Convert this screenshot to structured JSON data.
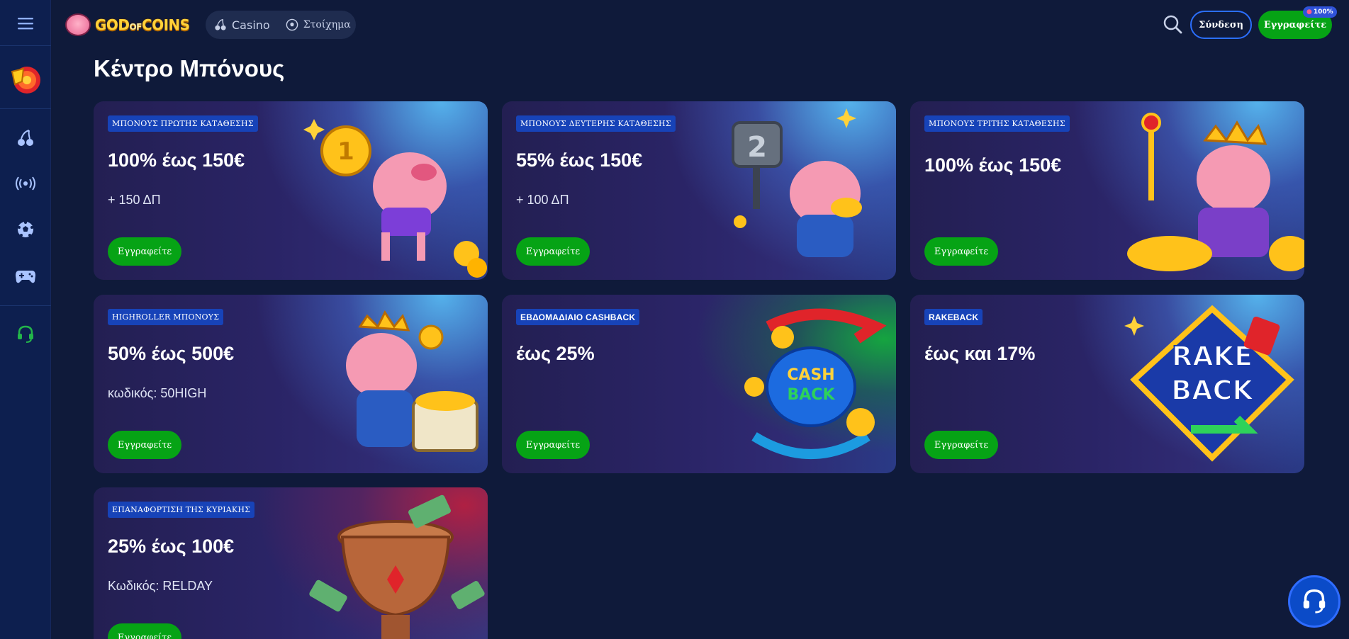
{
  "header": {
    "logo_text_a": "GOD",
    "logo_text_b": "OF",
    "logo_text_c": "COINS",
    "nav": [
      {
        "label": "Casino",
        "icon": "cherry-icon"
      },
      {
        "label": "Στοίχημα",
        "icon": "soccer-ball-icon"
      }
    ],
    "login_label": "Σύνδεση",
    "register_label": "Εγγραφείτε",
    "register_badge": "100%"
  },
  "sidebar": {
    "items": [
      {
        "name": "menu",
        "icon": "hamburger-menu-icon"
      },
      {
        "name": "promotions",
        "icon": "wheel-of-fortune-icon"
      },
      {
        "name": "casino",
        "icon": "cherry-icon"
      },
      {
        "name": "live",
        "icon": "broadcast-icon"
      },
      {
        "name": "sports",
        "icon": "soccer-ball-icon"
      },
      {
        "name": "games",
        "icon": "gamepad-icon"
      },
      {
        "name": "support",
        "icon": "headset-icon"
      }
    ]
  },
  "page": {
    "title": "Κέντρο Μπόνους"
  },
  "cards": [
    {
      "tag": "ΜΠΟΝΟΥΣ ΠΡΩΤΗΣ ΚΑΤΑΘΕΣΗΣ",
      "headline": "100% έως 150€",
      "sub": "+ 150 ΔΠ",
      "button": "Εγγραφείτε",
      "art": "pig-with-gold-coin"
    },
    {
      "tag": "ΜΠΟΝΟΥΣ ΔΕΥΤΕΡΗΣ ΚΑΤΑΘΕΣΗΣ",
      "headline": "55% έως 150€",
      "sub": "+ 100 ΔΠ",
      "button": "Εγγραφείτε",
      "art": "pig-with-hammer"
    },
    {
      "tag": "ΜΠΟΝΟΥΣ ΤΡΙΤΗΣ ΚΑΤΑΘΕΣΗΣ",
      "headline": "100% έως 150€",
      "sub": "",
      "button": "Εγγραφείτε",
      "art": "king-pig"
    },
    {
      "tag": "HIGHROLLER ΜΠΟΝΟΥΣ",
      "headline": "50% έως 500€",
      "sub": "κωδικός: 50HIGH",
      "button": "Εγγραφείτε",
      "art": "pig-with-treasure-chest"
    },
    {
      "tag": "ΕΒΔΟΜΑΔΙΑΙΟ CASHBACK",
      "headline": "έως 25%",
      "sub": "",
      "button": "Εγγραφείτε",
      "art": "cashback-bag"
    },
    {
      "tag": "RAKEBACK",
      "headline": "έως και 17%",
      "sub": "",
      "button": "Εγγραφείτε",
      "art": "rakeback-badge"
    },
    {
      "tag": "ΕΠΑΝΑΦΟΡΤΙΣΗ ΤΗΣ ΚΥΡΙΑΚΗΣ",
      "headline": "25% έως 100€",
      "sub": "Κωδικός: RELDAY",
      "button": "Εγγραφείτε",
      "art": "trophy-with-money"
    }
  ],
  "colors": {
    "background": "#0f1a3a",
    "sidebar": "#0d1f4f",
    "accent_green": "#06a315",
    "accent_blue": "#2b6fff",
    "tag_blue": "#1743b8"
  }
}
